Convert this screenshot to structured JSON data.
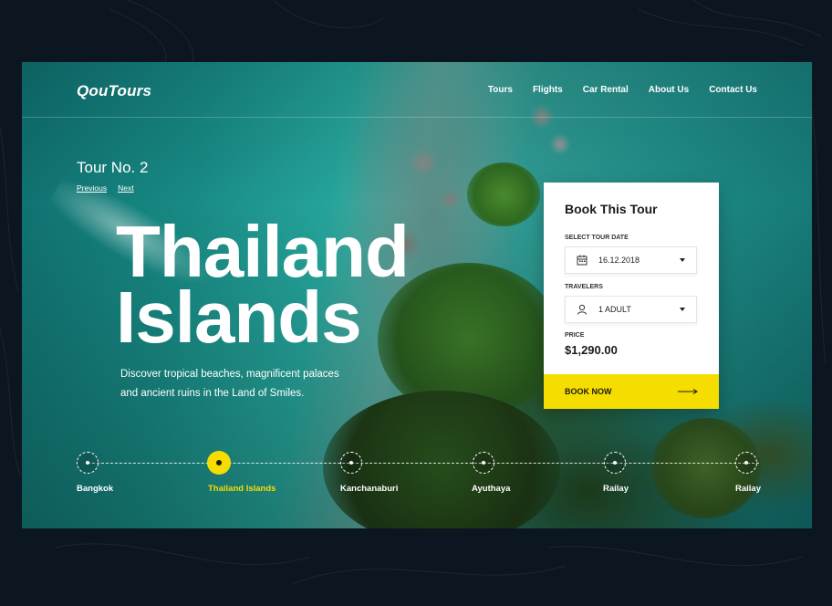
{
  "brand": {
    "logo": "QouTours"
  },
  "nav": {
    "items": [
      "Tours",
      "Flights",
      "Car Rental",
      "About Us",
      "Contact Us"
    ]
  },
  "tour": {
    "number_label": "Tour No. 2",
    "previous": "Previous",
    "next": "Next"
  },
  "hero": {
    "title_line1": "Thailand",
    "title_line2": "Islands",
    "description_line1": "Discover tropical beaches, magnificent palaces",
    "description_line2": "and ancient ruins in the Land of Smiles."
  },
  "timeline": {
    "stops": [
      "Bangkok",
      "Thailand Islands",
      "Kanchanaburi",
      "Ayuthaya",
      "Railay",
      "Railay"
    ],
    "active_index": 1
  },
  "booking": {
    "title": "Book This Tour",
    "date_label": "SELECT TOUR DATE",
    "date_value": "16.12.2018",
    "travelers_label": "TRAVELERS",
    "travelers_value": "1 ADULT",
    "price_label": "PRICE",
    "price_value": "$1,290.00",
    "button_label": "BOOK NOW"
  },
  "icons": {
    "date": "calendar-icon",
    "travelers": "user-icon",
    "dropdown": "chevron-down-icon",
    "button": "arrow-right-icon"
  },
  "colors": {
    "accent": "#f6dd00",
    "background": "#0c1620",
    "card": "#ffffff",
    "text_dark": "#1b1b1b"
  }
}
